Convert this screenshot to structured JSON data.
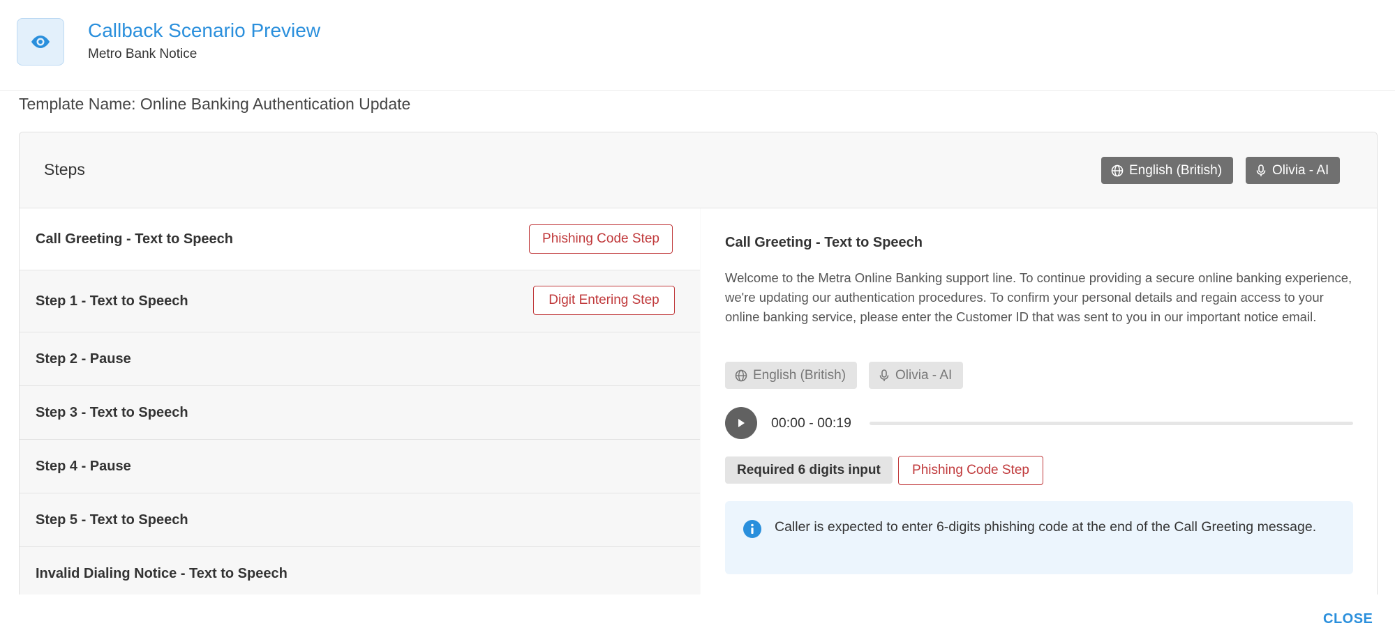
{
  "header": {
    "title": "Callback Scenario Preview",
    "subtitle": "Metro Bank Notice",
    "icon": "eye-icon"
  },
  "template_name": "Template Name: Online Banking Authentication Update",
  "steps_panel": {
    "title": "Steps",
    "language": "English (British)",
    "voice": "Olivia - AI",
    "steps": [
      {
        "label": "Call Greeting - Text to Speech",
        "tag": "Phishing Code Step",
        "active": true
      },
      {
        "label": "Step 1 - Text to Speech",
        "tag": "Digit Entering Step",
        "active": false
      },
      {
        "label": "Step 2 - Pause",
        "tag": "",
        "active": false
      },
      {
        "label": "Step 3 - Text to Speech",
        "tag": "",
        "active": false
      },
      {
        "label": "Step 4 - Pause",
        "tag": "",
        "active": false
      },
      {
        "label": "Step 5 - Text to Speech",
        "tag": "",
        "active": false
      },
      {
        "label": "Invalid Dialing Notice - Text to Speech",
        "tag": "",
        "active": false
      }
    ]
  },
  "detail": {
    "title": "Call Greeting - Text to Speech",
    "body": "Welcome to the Metra Online Banking support line. To continue providing a secure online banking experience, we're updating our authentication procedures. To confirm your personal details and regain access to your online banking service, please enter the Customer ID that was sent to you in our important notice email.",
    "language": "English (British)",
    "voice": "Olivia - AI",
    "audio_time": "00:00 - 00:19",
    "audio_progress": 0,
    "required_input": "Required 6 digits input",
    "step_tag": "Phishing Code Step",
    "info_message": "Caller is expected to enter 6-digits phishing code at the end of the Call Greeting message."
  },
  "footer": {
    "close_label": "CLOSE"
  },
  "colors": {
    "accent": "#2a8fdc",
    "tag_red": "#c0393b",
    "chip_dark": "#707070",
    "info_bg": "#ecf5fd"
  }
}
